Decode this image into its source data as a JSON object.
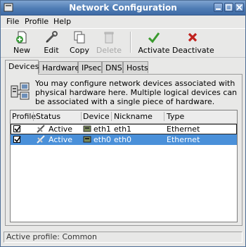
{
  "window": {
    "title": "Network Configuration"
  },
  "menu": {
    "file": "File",
    "profile": "Profile",
    "help": "Help"
  },
  "toolbar": {
    "new": "New",
    "edit": "Edit",
    "copy": "Copy",
    "delete": "Delete",
    "activate": "Activate",
    "deactivate": "Deactivate"
  },
  "tabs": [
    "Devices",
    "Hardware",
    "IPsec",
    "DNS",
    "Hosts"
  ],
  "info": "You may configure network devices associated with physical hardware here.  Multiple logical devices can be associated with a single piece of hardware.",
  "table": {
    "columns": [
      "Profile",
      "Status",
      "Device",
      "Nickname",
      "Type"
    ],
    "rows": [
      {
        "profile": true,
        "status": "Active",
        "device": "eth1",
        "nickname": "eth1",
        "type": "Ethernet",
        "selected": false
      },
      {
        "profile": true,
        "status": "Active",
        "device": "eth0",
        "nickname": "eth0",
        "type": "Ethernet",
        "selected": true
      }
    ]
  },
  "statusbar": {
    "text": "Active profile: Common"
  },
  "colors": {
    "selection": "#4a90d9",
    "titlebar": "#4f7cb4"
  }
}
